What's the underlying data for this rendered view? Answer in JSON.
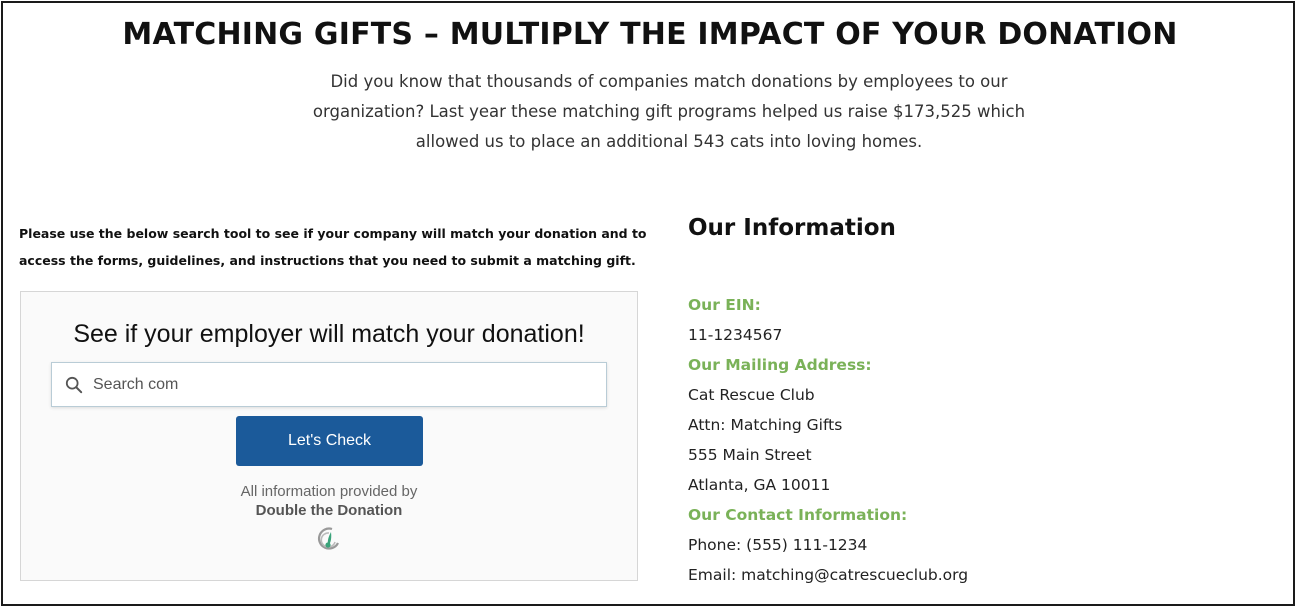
{
  "headline": "MATCHING GIFTS – MULTIPLY THE IMPACT OF YOUR DONATION",
  "intro": {
    "line1": "Did you know that thousands of companies match donations by employees to our",
    "line2": "organization? Last year these matching gift programs helped us raise $173,525 which",
    "line3": "allowed us to place an additional 543 cats into loving homes."
  },
  "instructions": {
    "line1": "Please use the below search tool to see if your company will match your donation and to",
    "line2": "access the forms, guidelines, and instructions that you need to submit a matching gift."
  },
  "widget": {
    "title": "See if your employer will match your donation!",
    "search_placeholder": "Search com",
    "button_label": "Let's Check",
    "provided_by": "All information provided by",
    "provider_name": "Double the Donation",
    "button_color": "#1b5a9a"
  },
  "info": {
    "heading": "Our Information",
    "ein_label": "Our EIN:",
    "ein_value": "11-1234567",
    "mailing_label": "Our Mailing Address:",
    "address_line1": "Cat Rescue Club",
    "address_line2": "Attn: Matching Gifts",
    "address_line3": "555 Main Street",
    "address_line4": "Atlanta, GA 10011",
    "contact_label": "Our Contact Information:",
    "phone": "Phone: (555) 111-1234",
    "email": "Email: matching@catrescueclub.org",
    "label_color": "#7ab258"
  },
  "icons": {
    "search": "search-icon",
    "logo": "double-the-donation-logo-icon"
  }
}
